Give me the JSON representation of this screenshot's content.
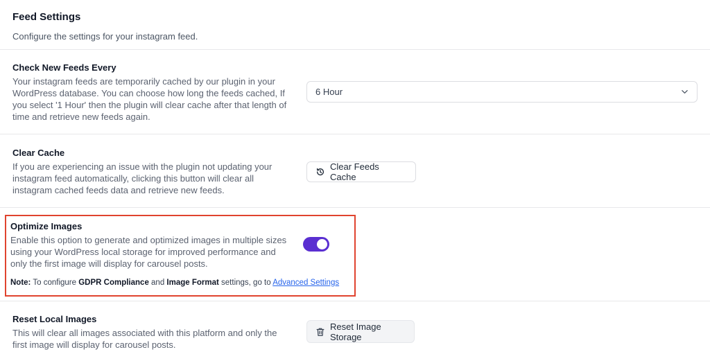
{
  "header": {
    "title": "Feed Settings",
    "subtitle": "Configure the settings for your instagram feed."
  },
  "check_feeds": {
    "title": "Check New Feeds Every",
    "description": "Your instagram feeds are temporarily cached by our plugin in your WordPress database. You can choose how long the feeds cached, If you select '1 Hour' then the plugin will clear cache after that length of time and retrieve new feeds again.",
    "select_value": "6 Hour",
    "select_icon": "chevron-down-icon"
  },
  "clear_cache": {
    "title": "Clear Cache",
    "description": "If you are experiencing an issue with the plugin not updating your instagram feed automatically, clicking this button will clear all instagram cached feeds data and retrieve new feeds.",
    "button_label": "Clear Feeds Cache",
    "button_icon": "history-icon"
  },
  "optimize_images": {
    "title": "Optimize Images",
    "description": "Enable this option to generate and optimized images in multiple sizes using your WordPress local storage for improved performance and only the first image will display for carousel posts.",
    "toggle_on": true,
    "note_label": "Note:",
    "note_text_1": " To configure ",
    "note_bold_1": "GDPR Compliance",
    "note_text_2": " and ",
    "note_bold_2": "Image Format",
    "note_text_3": " settings, go to ",
    "note_link": "Advanced Settings"
  },
  "reset_images": {
    "title": "Reset Local Images",
    "description": "This will clear all images associated with this platform and only the first image will display for carousel posts.",
    "button_label": "Reset Image Storage",
    "button_icon": "trash-icon"
  },
  "colors": {
    "toggle_on": "#5a2fd1",
    "highlight_border": "#e0432e",
    "link": "#2563eb"
  }
}
